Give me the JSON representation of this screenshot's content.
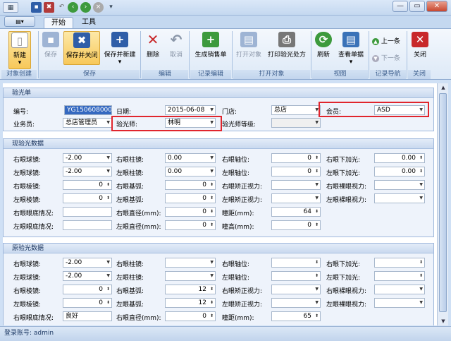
{
  "quick_access": {
    "icons": [
      "app-menu-icon",
      "save-icon",
      "save-close-icon",
      "undo-icon",
      "back-icon",
      "forward-icon",
      "stop-icon",
      "dropdown-icon"
    ]
  },
  "window_buttons": {
    "minimize": "—",
    "restore": "▭",
    "close": "✕"
  },
  "tabs": {
    "file": "▤▾",
    "start": "开始",
    "tools": "工具"
  },
  "ribbon": {
    "new": "新建",
    "new_group": "对象创建",
    "save": "保存",
    "save_close": "保存并关闭",
    "save_new": "保存并新建",
    "save_group": "保存",
    "delete": "删除",
    "cancel": "取消",
    "edit_group": "编辑",
    "gen_sales": "生成销售单",
    "record_group": "记录编辑",
    "open_obj": "打开对象",
    "print_rx": "打印验光处方",
    "open_group": "打开对象",
    "refresh": "刷新",
    "view_list": "查看单据",
    "view_group": "视图",
    "prev": "上一条",
    "next": "下一条",
    "nav_group": "记录导航",
    "close": "关闭",
    "close_group": "关闭"
  },
  "header": {
    "title": "验光单",
    "number_label": "编号:",
    "number_value": "YG150608000",
    "date_label": "日期:",
    "date_value": "2015-06-08",
    "store_label": "门店:",
    "store_value": "总店",
    "member_label": "会员:",
    "member_value": "ASD",
    "salesman_label": "业务员:",
    "salesman_value": "总店管理员",
    "optometrist_label": "验光师:",
    "optometrist_value": "林明",
    "optometrist_level_label": "验光师等级:",
    "optometrist_level_value": ""
  },
  "current": {
    "title": "现验光数据",
    "rows": [
      {
        "l1": "右眼球镜:",
        "v1": "-2.00",
        "l2": "右眼柱镜:",
        "v2": "0.00",
        "l3": "右眼轴位:",
        "v3": "0",
        "l4": "右眼下加光:",
        "v4": "0.00"
      },
      {
        "l1": "左眼球镜:",
        "v1": "-2.00",
        "l2": "左眼柱镜:",
        "v2": "0.00",
        "l3": "左眼轴位:",
        "v3": "0",
        "l4": "左眼下加光:",
        "v4": "0.00"
      },
      {
        "l1": "右眼棱镜:",
        "v1": "0",
        "l2": "右眼基弧:",
        "v2": "0",
        "l3": "右眼矫正视力:",
        "v3": "",
        "l4": "右眼裸眼视力:",
        "v4": ""
      },
      {
        "l1": "左眼棱镜:",
        "v1": "0",
        "l2": "左眼基弧:",
        "v2": "0",
        "l3": "左眼矫正视力:",
        "v3": "",
        "l4": "左眼裸眼视力:",
        "v4": ""
      },
      {
        "l1": "右眼眼底情况:",
        "v1": "",
        "l2": "右眼直径(mm):",
        "v2": "0",
        "l3": "瞳距(mm):",
        "v3": "64"
      },
      {
        "l1": "左眼眼底情况:",
        "v1": "",
        "l2": "左眼直径(mm):",
        "v2": "0",
        "l3": "瞳高(mm):",
        "v3": "0"
      }
    ]
  },
  "original": {
    "title": "原验光数据",
    "rows": [
      {
        "l1": "右眼球镜:",
        "v1": "-2.00",
        "l2": "右眼柱镜:",
        "v2": "",
        "l3": "右眼轴位:",
        "v3": "",
        "l4": "右眼下加光:",
        "v4": ""
      },
      {
        "l1": "左眼球镜:",
        "v1": "-2.00",
        "l2": "左眼柱镜:",
        "v2": "",
        "l3": "左眼轴位:",
        "v3": "",
        "l4": "左眼下加光:",
        "v4": ""
      },
      {
        "l1": "右眼棱镜:",
        "v1": "0",
        "l2": "右眼基弧:",
        "v2": "12",
        "l3": "右眼矫正视力:",
        "v3": "",
        "l4": "右眼裸眼视力:",
        "v4": ""
      },
      {
        "l1": "左眼棱镜:",
        "v1": "0",
        "l2": "左眼基弧:",
        "v2": "12",
        "l3": "左眼矫正视力:",
        "v3": "",
        "l4": "左眼裸眼视力:",
        "v4": ""
      },
      {
        "l1": "右眼眼底情况:",
        "v1": "良好",
        "l2": "右眼直径(mm):",
        "v2": "0",
        "l3": "瞳距(mm):",
        "v3": "65"
      }
    ]
  },
  "status": {
    "text": "登录账号: admin"
  }
}
